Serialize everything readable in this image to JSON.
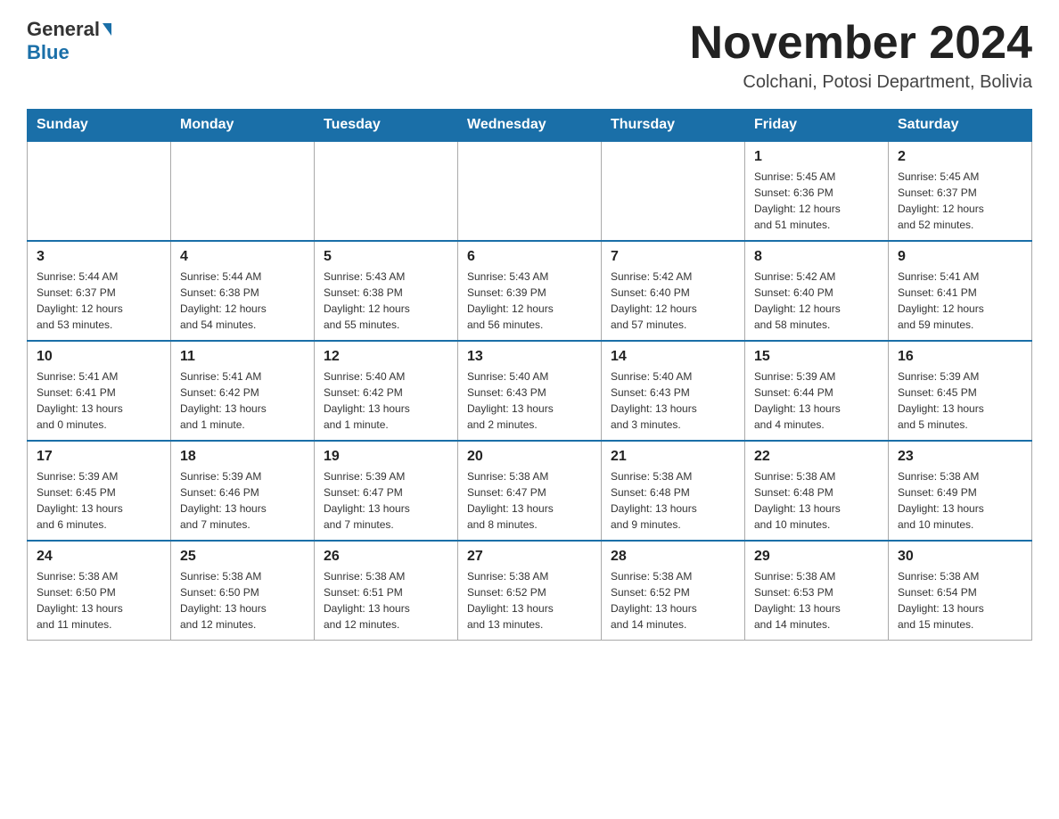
{
  "header": {
    "logo_text_general": "General",
    "logo_text_blue": "Blue",
    "month_year": "November 2024",
    "location": "Colchani, Potosi Department, Bolivia"
  },
  "weekdays": [
    "Sunday",
    "Monday",
    "Tuesday",
    "Wednesday",
    "Thursday",
    "Friday",
    "Saturday"
  ],
  "weeks": [
    [
      {
        "day": "",
        "info": ""
      },
      {
        "day": "",
        "info": ""
      },
      {
        "day": "",
        "info": ""
      },
      {
        "day": "",
        "info": ""
      },
      {
        "day": "",
        "info": ""
      },
      {
        "day": "1",
        "info": "Sunrise: 5:45 AM\nSunset: 6:36 PM\nDaylight: 12 hours\nand 51 minutes."
      },
      {
        "day": "2",
        "info": "Sunrise: 5:45 AM\nSunset: 6:37 PM\nDaylight: 12 hours\nand 52 minutes."
      }
    ],
    [
      {
        "day": "3",
        "info": "Sunrise: 5:44 AM\nSunset: 6:37 PM\nDaylight: 12 hours\nand 53 minutes."
      },
      {
        "day": "4",
        "info": "Sunrise: 5:44 AM\nSunset: 6:38 PM\nDaylight: 12 hours\nand 54 minutes."
      },
      {
        "day": "5",
        "info": "Sunrise: 5:43 AM\nSunset: 6:38 PM\nDaylight: 12 hours\nand 55 minutes."
      },
      {
        "day": "6",
        "info": "Sunrise: 5:43 AM\nSunset: 6:39 PM\nDaylight: 12 hours\nand 56 minutes."
      },
      {
        "day": "7",
        "info": "Sunrise: 5:42 AM\nSunset: 6:40 PM\nDaylight: 12 hours\nand 57 minutes."
      },
      {
        "day": "8",
        "info": "Sunrise: 5:42 AM\nSunset: 6:40 PM\nDaylight: 12 hours\nand 58 minutes."
      },
      {
        "day": "9",
        "info": "Sunrise: 5:41 AM\nSunset: 6:41 PM\nDaylight: 12 hours\nand 59 minutes."
      }
    ],
    [
      {
        "day": "10",
        "info": "Sunrise: 5:41 AM\nSunset: 6:41 PM\nDaylight: 13 hours\nand 0 minutes."
      },
      {
        "day": "11",
        "info": "Sunrise: 5:41 AM\nSunset: 6:42 PM\nDaylight: 13 hours\nand 1 minute."
      },
      {
        "day": "12",
        "info": "Sunrise: 5:40 AM\nSunset: 6:42 PM\nDaylight: 13 hours\nand 1 minute."
      },
      {
        "day": "13",
        "info": "Sunrise: 5:40 AM\nSunset: 6:43 PM\nDaylight: 13 hours\nand 2 minutes."
      },
      {
        "day": "14",
        "info": "Sunrise: 5:40 AM\nSunset: 6:43 PM\nDaylight: 13 hours\nand 3 minutes."
      },
      {
        "day": "15",
        "info": "Sunrise: 5:39 AM\nSunset: 6:44 PM\nDaylight: 13 hours\nand 4 minutes."
      },
      {
        "day": "16",
        "info": "Sunrise: 5:39 AM\nSunset: 6:45 PM\nDaylight: 13 hours\nand 5 minutes."
      }
    ],
    [
      {
        "day": "17",
        "info": "Sunrise: 5:39 AM\nSunset: 6:45 PM\nDaylight: 13 hours\nand 6 minutes."
      },
      {
        "day": "18",
        "info": "Sunrise: 5:39 AM\nSunset: 6:46 PM\nDaylight: 13 hours\nand 7 minutes."
      },
      {
        "day": "19",
        "info": "Sunrise: 5:39 AM\nSunset: 6:47 PM\nDaylight: 13 hours\nand 7 minutes."
      },
      {
        "day": "20",
        "info": "Sunrise: 5:38 AM\nSunset: 6:47 PM\nDaylight: 13 hours\nand 8 minutes."
      },
      {
        "day": "21",
        "info": "Sunrise: 5:38 AM\nSunset: 6:48 PM\nDaylight: 13 hours\nand 9 minutes."
      },
      {
        "day": "22",
        "info": "Sunrise: 5:38 AM\nSunset: 6:48 PM\nDaylight: 13 hours\nand 10 minutes."
      },
      {
        "day": "23",
        "info": "Sunrise: 5:38 AM\nSunset: 6:49 PM\nDaylight: 13 hours\nand 10 minutes."
      }
    ],
    [
      {
        "day": "24",
        "info": "Sunrise: 5:38 AM\nSunset: 6:50 PM\nDaylight: 13 hours\nand 11 minutes."
      },
      {
        "day": "25",
        "info": "Sunrise: 5:38 AM\nSunset: 6:50 PM\nDaylight: 13 hours\nand 12 minutes."
      },
      {
        "day": "26",
        "info": "Sunrise: 5:38 AM\nSunset: 6:51 PM\nDaylight: 13 hours\nand 12 minutes."
      },
      {
        "day": "27",
        "info": "Sunrise: 5:38 AM\nSunset: 6:52 PM\nDaylight: 13 hours\nand 13 minutes."
      },
      {
        "day": "28",
        "info": "Sunrise: 5:38 AM\nSunset: 6:52 PM\nDaylight: 13 hours\nand 14 minutes."
      },
      {
        "day": "29",
        "info": "Sunrise: 5:38 AM\nSunset: 6:53 PM\nDaylight: 13 hours\nand 14 minutes."
      },
      {
        "day": "30",
        "info": "Sunrise: 5:38 AM\nSunset: 6:54 PM\nDaylight: 13 hours\nand 15 minutes."
      }
    ]
  ]
}
